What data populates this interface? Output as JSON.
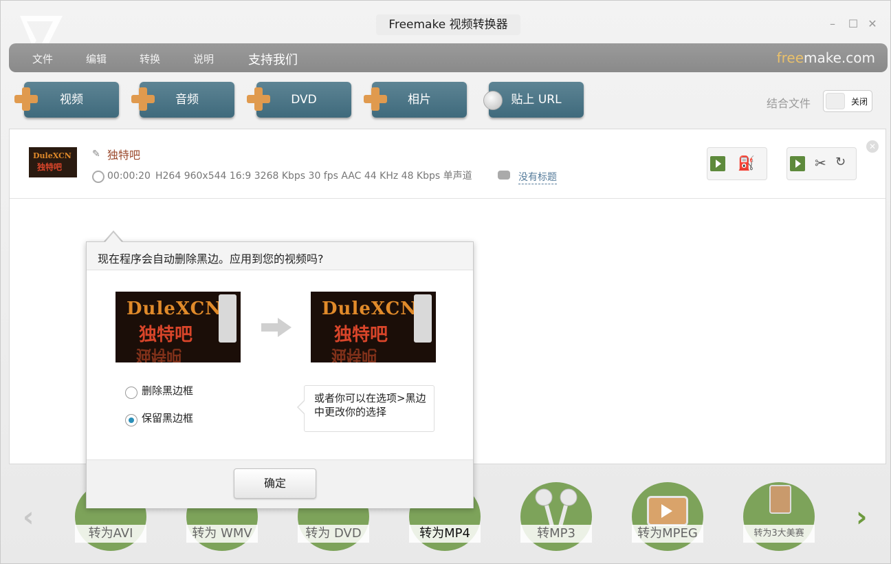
{
  "window": {
    "title": "Freemake 视频转换器",
    "controls": [
      "–",
      "☐",
      "✕"
    ]
  },
  "menu": {
    "items": [
      "文件",
      "编辑",
      "转换",
      "说明"
    ],
    "support": "支持我们",
    "brand_free": "free",
    "brand_rest": "make.com"
  },
  "toolbar": {
    "buttons": [
      "视频",
      "音频",
      "DVD",
      "相片",
      "贴上 URL"
    ],
    "join_label": "结合文件",
    "join_toggle": "关闭"
  },
  "file": {
    "name": "独特吧",
    "duration": "00:00:20",
    "specs": "H264 960x544 16:9 3268 Kbps 30 fps AAC 44 KHz 48 Kbps 单声道",
    "subtitle": "没有标题"
  },
  "dialog": {
    "title": "现在程序会自动删除黑边。应用到您的视频吗?",
    "option_remove": "删除黑边框",
    "option_keep": "保留黑边框",
    "selected": "option_keep",
    "hint": "或者你可以在选项>黑边中更改你的选择",
    "ok": "确定",
    "preview_text_top": "DuleXCN",
    "preview_text_mid": "独特吧",
    "preview_text_reflect": "独特吧"
  },
  "formats": [
    "转为AVI",
    "转为 WMV",
    "转为 DVD",
    "转为MP4",
    "转MP3",
    "转为MPEG",
    "转为3大美赛"
  ],
  "colors": {
    "accent_button": "#4f7888",
    "plus_orange": "#e09a4e",
    "format_green": "#7da35a",
    "nav_arrow_green": "#6d9a3e"
  }
}
